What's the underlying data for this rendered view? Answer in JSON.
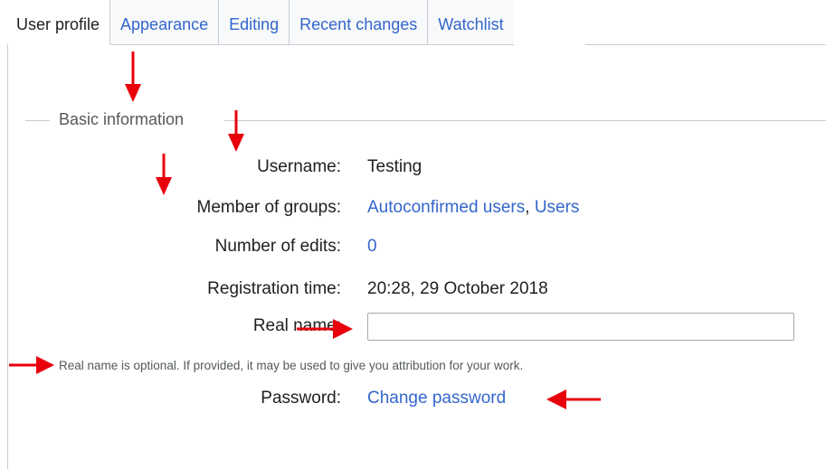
{
  "tabs": [
    {
      "label": "User profile",
      "active": true
    },
    {
      "label": "Appearance",
      "active": false
    },
    {
      "label": "Editing",
      "active": false
    },
    {
      "label": "Recent changes",
      "active": false
    },
    {
      "label": "Watchlist",
      "active": false
    }
  ],
  "section": {
    "legend": "Basic information"
  },
  "fields": {
    "username": {
      "label": "Username:",
      "value": "Testing"
    },
    "groups": {
      "label": "Member of groups:",
      "group1": "Autoconfirmed users",
      "separator": ",",
      "group2": "Users"
    },
    "edits": {
      "label": "Number of edits:",
      "value": "0"
    },
    "registration": {
      "label": "Registration time:",
      "value": "20:28, 29 October 2018"
    },
    "real_name": {
      "label": "Real name:",
      "value": "",
      "placeholder": ""
    },
    "real_name_help": "Real name is optional. If provided, it may be used to give you attribution for your work.",
    "password": {
      "label": "Password:",
      "link": "Change password"
    }
  },
  "colors": {
    "link": "#3366cc",
    "text": "#202122",
    "muted": "#54595d",
    "border": "#c8ccd1",
    "annotation_arrow": "#e8000b"
  },
  "icons": {
    "annotation": "red-arrow-icon"
  }
}
